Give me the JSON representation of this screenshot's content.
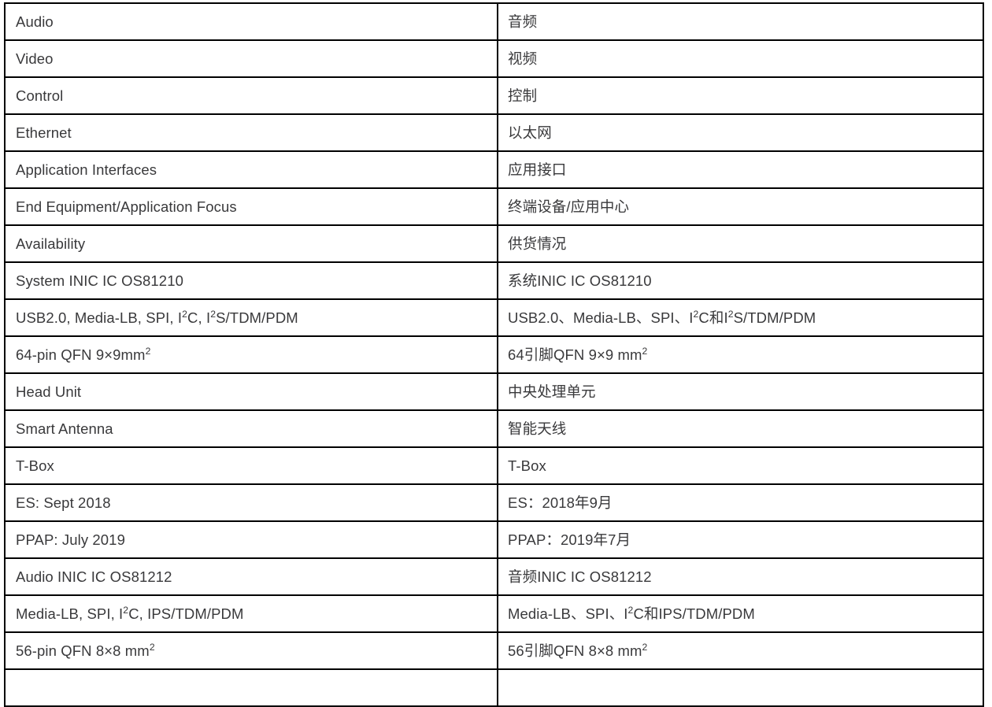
{
  "document": {
    "type": "bilingual-specification-table",
    "columns": [
      "English",
      "Chinese"
    ],
    "border_color": "#000000",
    "text_color": "#39393b",
    "background_color": "#ffffff"
  },
  "table": {
    "rows": [
      {
        "en": "Audio",
        "zh": "音频"
      },
      {
        "en": "Video",
        "zh": "视频"
      },
      {
        "en": "Control",
        "zh": "控制"
      },
      {
        "en": "Ethernet",
        "zh": "以太网"
      },
      {
        "en": "Application Interfaces",
        "zh": "应用接口"
      },
      {
        "en": "End Equipment/Application Focus",
        "zh": "终端设备/应用中心"
      },
      {
        "en": "Availability",
        "zh": "供货情况"
      },
      {
        "en": "System INIC IC OS81210",
        "zh": "系统INIC IC OS81210"
      },
      {
        "en": "USB2.0, Media-LB, SPI, I<sup>2</sup>C, I<sup>2</sup>S/TDM/PDM",
        "zh": "USB2.0、Media-LB、SPI、I<sup>2</sup>C和I<sup>2</sup>S/TDM/PDM",
        "html": true
      },
      {
        "en": "64-pin QFN 9×9mm<sup>2</sup>",
        "zh": "64引脚QFN 9×9 mm<sup>2</sup>",
        "html": true
      },
      {
        "en": "Head Unit",
        "zh": "中央处理单元"
      },
      {
        "en": "Smart Antenna",
        "zh": "智能天线"
      },
      {
        "en": "T-Box",
        "zh": "T-Box"
      },
      {
        "en": "ES: Sept 2018",
        "zh": "ES：2018年9月"
      },
      {
        "en": "PPAP: July 2019",
        "zh": "PPAP：2019年7月"
      },
      {
        "en": "Audio INIC IC OS81212",
        "zh": "音频INIC IC OS81212"
      },
      {
        "en": "Media-LB, SPI, I<sup>2</sup>C, IPS/TDM/PDM",
        "zh": "Media-LB、SPI、I<sup>2</sup>C和IPS/TDM/PDM",
        "html": true
      },
      {
        "en": "56-pin QFN 8×8 mm<sup>2</sup>",
        "zh": "56引脚QFN 8×8 mm<sup>2</sup>",
        "html": true
      },
      {
        "en": "",
        "zh": ""
      }
    ]
  }
}
